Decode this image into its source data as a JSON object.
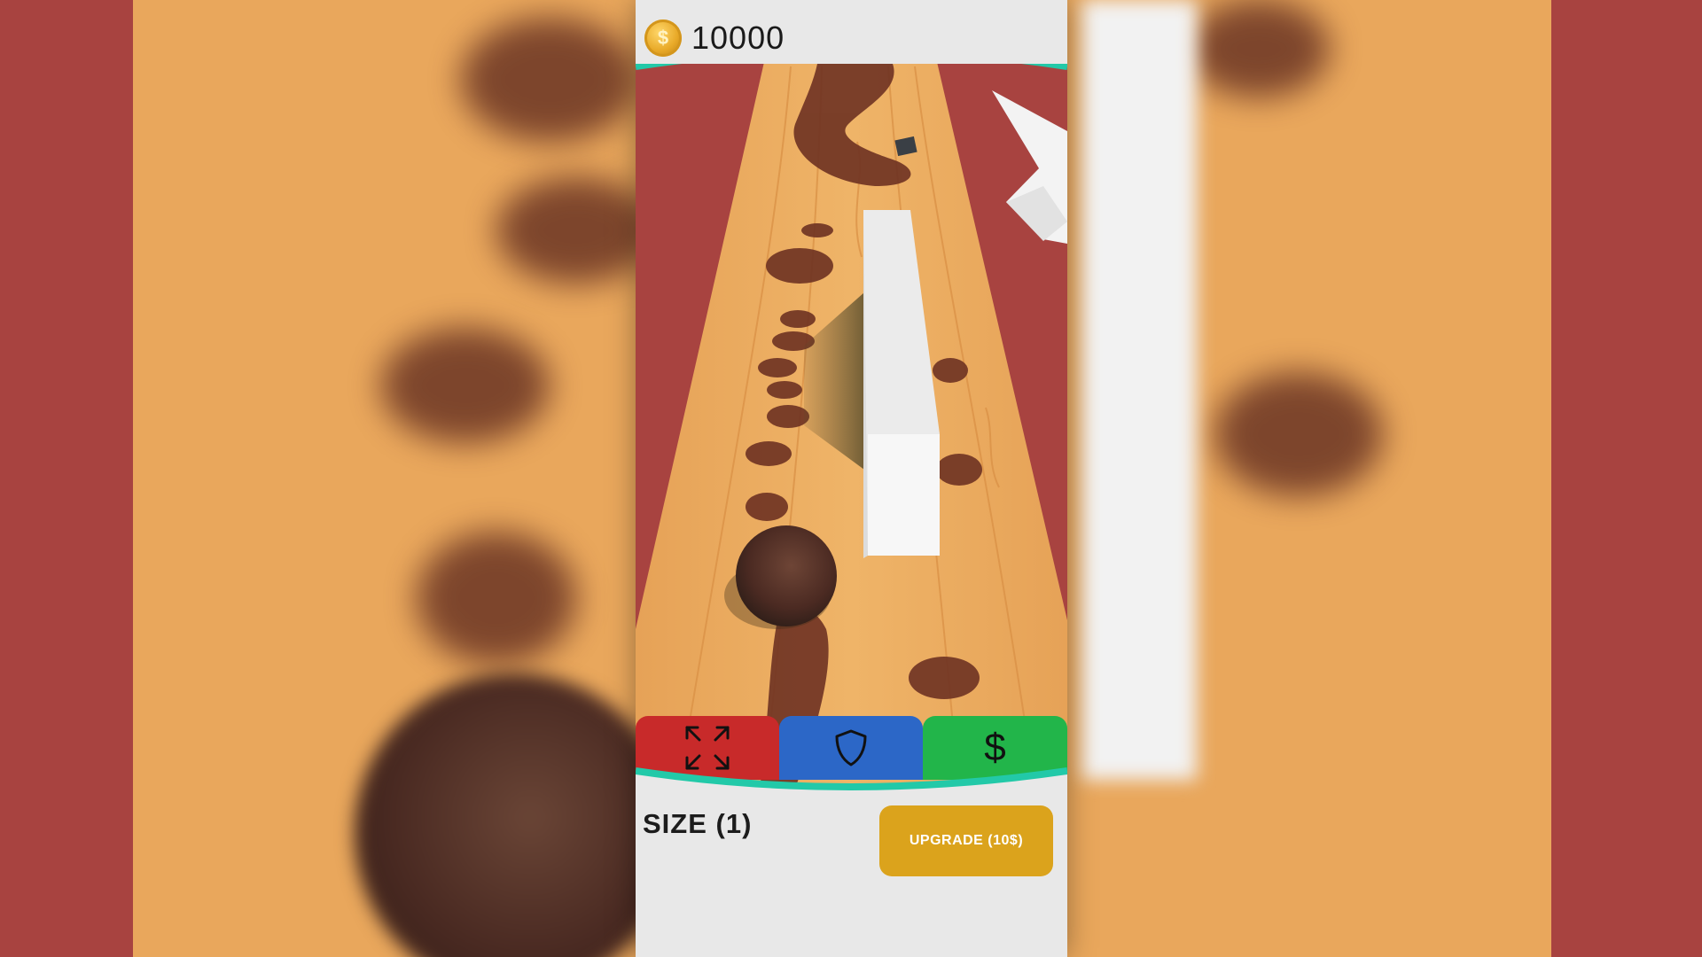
{
  "hud": {
    "coin_icon": "coin-icon",
    "coins": "10000"
  },
  "powerups": [
    {
      "name": "size",
      "icon": "expand-arrows-icon",
      "color": "#c82a2a"
    },
    {
      "name": "shield",
      "icon": "shield-icon",
      "color": "#2c67c7"
    },
    {
      "name": "money",
      "icon": "dollar-icon",
      "glyph": "$",
      "color": "#22b54a"
    }
  ],
  "upgrade_panel": {
    "size_label": "SIZE (1)",
    "upgrade_button": "UPGRADE (10$)"
  },
  "colors": {
    "accent_teal": "#22c9a8",
    "track_wood": "#e9a75c",
    "background_red": "#a84340",
    "upgrade_gold": "#dba31c"
  }
}
